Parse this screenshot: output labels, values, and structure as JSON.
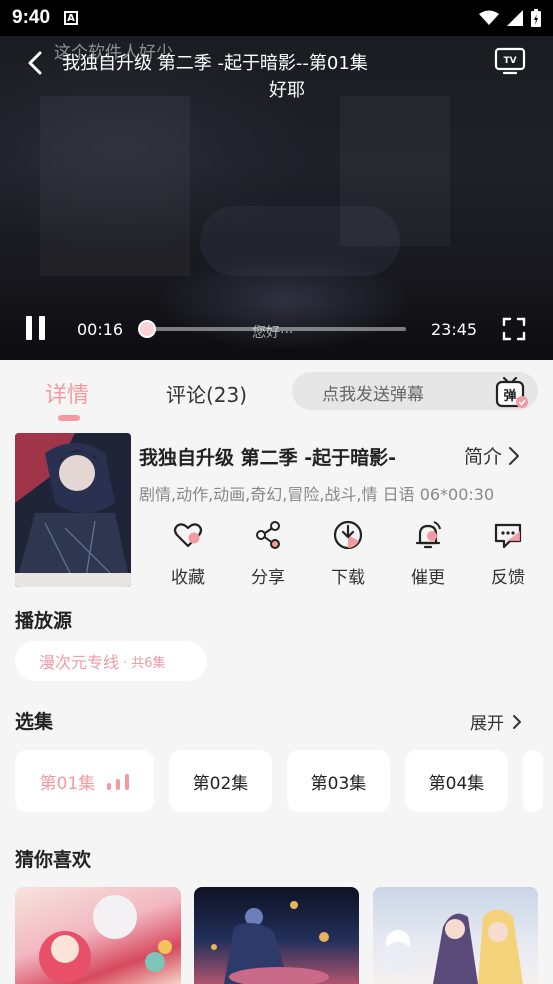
{
  "status_bar": {
    "time": "9:40",
    "notification_icon": "A"
  },
  "player": {
    "title": "我独自升级 第二季 -起于暗影--第01集",
    "danmaku": [
      "这个软件人好少",
      "好耶",
      "您好···"
    ],
    "current_time": "00:16",
    "total_time": "23:45",
    "progress_fraction": 0.011
  },
  "tabs": {
    "detail": "详情",
    "comments": "评论(23)"
  },
  "danmaku_input": {
    "placeholder": "点我发送弹幕"
  },
  "show": {
    "title": "我独自升级 第二季 -起于暗影-",
    "intro_label": "简介",
    "tags": "剧情,动作,动画,奇幻,冒险,战斗,情 日语 06*00:30"
  },
  "actions": [
    "收藏",
    "分享",
    "下载",
    "催更",
    "反馈"
  ],
  "source": {
    "title": "播放源",
    "name": "漫次元专线",
    "count": "· 共6集"
  },
  "episodes": {
    "title": "选集",
    "expand_label": "展开",
    "items": [
      "第01集",
      "第02集",
      "第03集",
      "第04集"
    ]
  },
  "recommend": {
    "title": "猜你喜欢"
  },
  "colors": {
    "accent": "#f19aa2",
    "background": "#f5f5f5"
  }
}
